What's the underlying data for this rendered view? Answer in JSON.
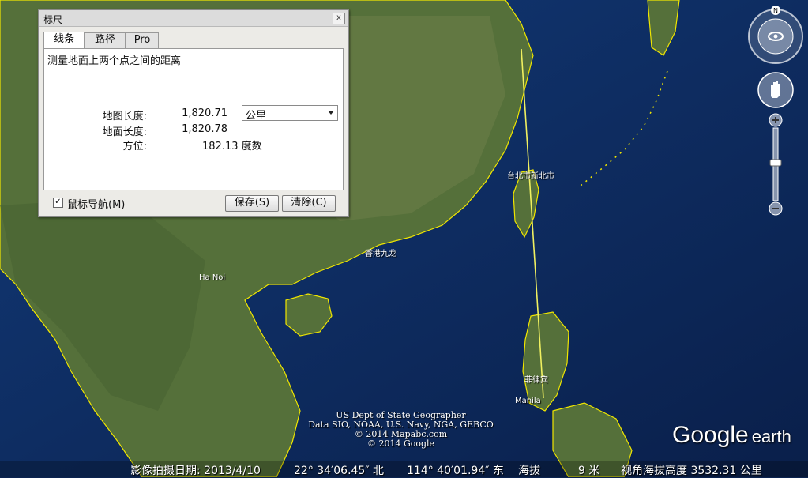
{
  "ruler": {
    "title": "标尺",
    "close": "x",
    "tabs": [
      "线条",
      "路径",
      "Pro"
    ],
    "description": "测量地面上两个点之间的距离",
    "map_length_label": "地图长度:",
    "map_length_value": "1,820.71",
    "unit_selected": "公里",
    "ground_length_label": "地面长度:",
    "ground_length_value": "1,820.78",
    "heading_label": "方位:",
    "heading_value": "182.13 度数",
    "mouse_nav_label": "鼠标导航(M)",
    "save_label": "保存(S)",
    "clear_label": "清除(C)"
  },
  "map_labels": {
    "taipei": "台北市新北市",
    "hanoi": "Ha Noi",
    "hongkong": "香港九龙",
    "manila": "Manila",
    "philippines": "菲律宾"
  },
  "nav": {
    "north": "N"
  },
  "credits": [
    "US Dept of State Geographer",
    "Data SIO, NOAA, U.S. Navy, NGA, GEBCO",
    "© 2014 Mapabc.com",
    "© 2014 Google"
  ],
  "logo": {
    "google": "Google",
    "earth": "earth"
  },
  "status": {
    "imagery_date": "影像拍摄日期: 2013/4/10",
    "lat": "22° 34′06.45″ 北",
    "lon": "114° 40′01.94″ 东",
    "elev_label": "海拔",
    "elev_value": "9 米",
    "eye_alt": "视角海拔高度 3532.31 公里"
  },
  "colors": {
    "water": "#0d2a5e",
    "land": "#3d5a2c",
    "border": "#f0e600"
  }
}
